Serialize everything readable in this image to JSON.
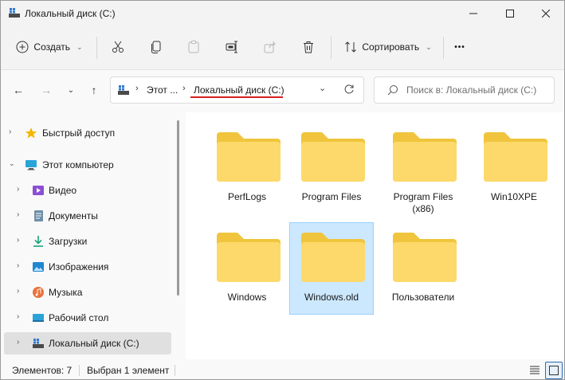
{
  "window": {
    "title": "Локальный диск (C:)",
    "controls": {
      "minimize": "—",
      "maximize": "☐",
      "close": "✕"
    }
  },
  "toolbar": {
    "new_label": "Создать",
    "sort_label": "Сортировать",
    "more_label": "•••"
  },
  "address": {
    "crumbs": [
      "Этот ...",
      "Локальный диск (C:)"
    ],
    "search_placeholder": "Поиск в: Локальный диск (C:)"
  },
  "nav": {
    "quick_access": "Быстрый доступ",
    "this_pc": "Этот компьютер",
    "items": [
      {
        "label": "Видео",
        "icon": "video-icon"
      },
      {
        "label": "Документы",
        "icon": "documents-icon"
      },
      {
        "label": "Загрузки",
        "icon": "downloads-icon"
      },
      {
        "label": "Изображения",
        "icon": "pictures-icon"
      },
      {
        "label": "Музыка",
        "icon": "music-icon"
      },
      {
        "label": "Рабочий стол",
        "icon": "desktop-icon"
      },
      {
        "label": "Локальный диск (C:)",
        "icon": "drive-icon",
        "selected": true
      }
    ]
  },
  "folders": [
    {
      "name": "PerfLogs"
    },
    {
      "name": "Program Files"
    },
    {
      "name": "Program Files (x86)"
    },
    {
      "name": "Win10XPE"
    },
    {
      "name": "Windows"
    },
    {
      "name": "Windows.old",
      "selected": true
    },
    {
      "name": "Пользователи"
    }
  ],
  "status": {
    "items_count": "Элементов: 7",
    "selected": "Выбран 1 элемент"
  },
  "colors": {
    "folder_back": "#f0c53d",
    "folder_front": "#fcd96a",
    "selection_bg": "#cce8ff",
    "accent": "#0067c0",
    "underline": "#d61f1f"
  }
}
